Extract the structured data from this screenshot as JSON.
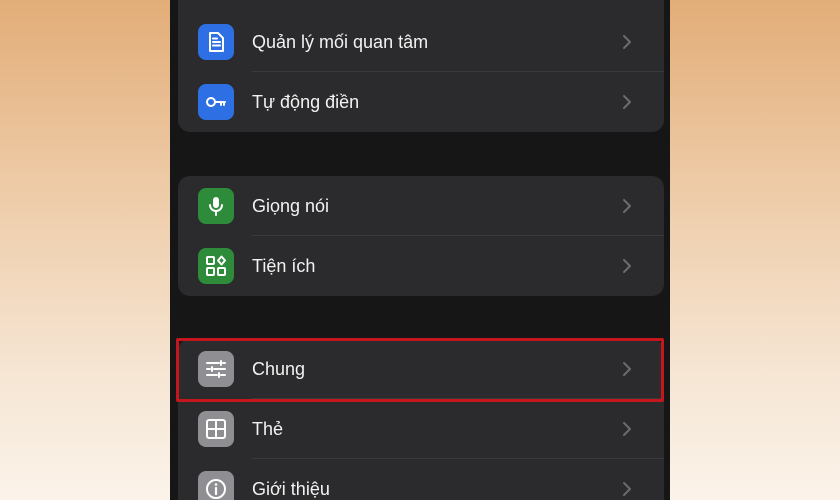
{
  "colors": {
    "blue_tile": "#2f6fe4",
    "green_tile": "#2e8b3a",
    "gray_tile": "#8e8e93",
    "highlight": "#c4161c"
  },
  "groups": [
    {
      "items": [
        {
          "label": "Quản lý mối quan tâm",
          "icon": "document-icon"
        },
        {
          "label": "Tự động điền",
          "icon": "key-icon"
        }
      ]
    },
    {
      "items": [
        {
          "label": "Giọng nói",
          "icon": "microphone-icon"
        },
        {
          "label": "Tiện ích",
          "icon": "widgets-icon"
        }
      ]
    },
    {
      "items": [
        {
          "label": "Chung",
          "icon": "sliders-icon",
          "highlighted": true
        },
        {
          "label": "Thẻ",
          "icon": "grid-icon"
        },
        {
          "label": "Giới thiệu",
          "icon": "info-icon"
        }
      ]
    }
  ]
}
